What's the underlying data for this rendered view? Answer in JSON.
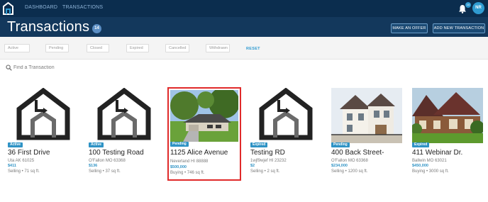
{
  "nav": {
    "dashboard": "DASHBOARD",
    "transactions": "TRANSACTIONS",
    "notifications_count": "10",
    "user_initials": "NR"
  },
  "header": {
    "title": "Transactions",
    "count": "14",
    "make_offer": "MAKE AN OFFER",
    "add_new": "ADD NEW TRANSACTION"
  },
  "filters": {
    "items": [
      "Active",
      "Pending",
      "Closed",
      "Expired",
      "Cancelled",
      "Withdrawn"
    ],
    "reset": "RESET"
  },
  "search": {
    "placeholder": "Find a Transaction"
  },
  "cards": [
    {
      "status": "Active",
      "address": "36 First Drive",
      "city": "Uta AK 61025",
      "price": "$411",
      "meta": "Selling • 71 sq ft.",
      "image": "logo-placeholder"
    },
    {
      "status": "Active",
      "address": "100 Testing Road",
      "city": "O'Fallon MO 63368",
      "price": "$136",
      "meta": "Selling • 37 sq ft.",
      "image": "logo-placeholder"
    },
    {
      "status": "Pending",
      "address": "1125 Alice Avenue",
      "city": "Neverland HI 88888",
      "price": "$500,000",
      "meta": "Buying • 746 sq ft.",
      "image": "house-photo"
    },
    {
      "status": "Expired",
      "address": "Testing RD",
      "city": "1wjf9wjef HI 23232",
      "price": "$2",
      "meta": "Selling • 2 sq ft.",
      "image": "logo-placeholder"
    },
    {
      "status": "Pending",
      "address": "400 Back Street-",
      "city": "O'Fallon MO 63368",
      "price": "$234,000",
      "meta": "Selling • 1200 sq ft.",
      "image": "house-photo"
    },
    {
      "status": "Expired",
      "address": "411 Webinar Dr.",
      "city": "Ballwin MO 63021",
      "price": "$450,000",
      "meta": "Buying • 3000 sq ft.",
      "image": "house-photo"
    }
  ],
  "colors": {
    "nav_bg": "#0b2d4e",
    "header_bg": "#13385c",
    "accent": "#2f93c5",
    "selected_border": "#e02a2a"
  }
}
